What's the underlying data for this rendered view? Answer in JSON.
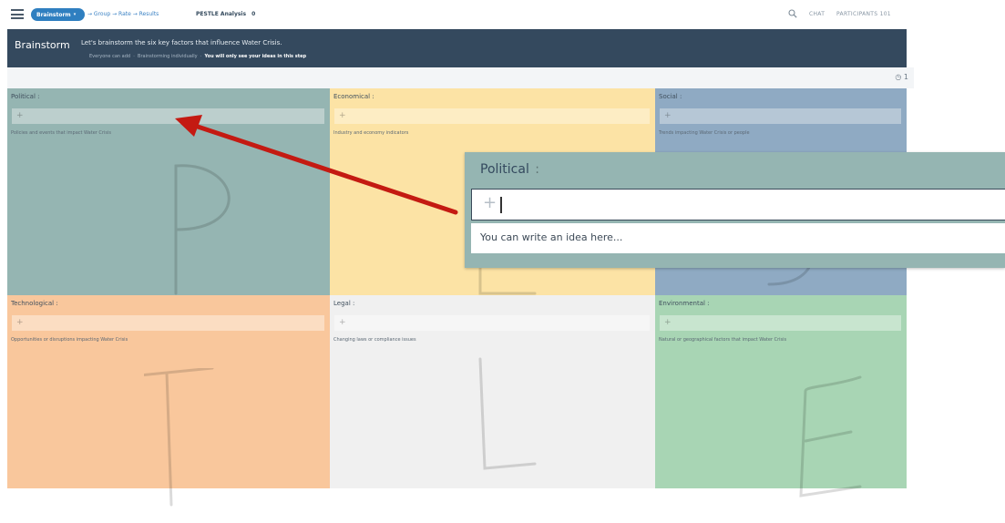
{
  "topbar": {
    "current_step": "Brainstorm",
    "steps_trail": "→ Group → Rate → Results",
    "board_title": "PESTLE Analysis",
    "board_count": "0",
    "chat_label": "CHAT",
    "participants_label": "PARTICIPANTS 101"
  },
  "banner": {
    "title": "Brainstorm",
    "instruction": "Let's brainstorm the six key factors that influence Water Crisis.",
    "sub_everyone": "Everyone can add",
    "sub_individual": "Brainstorming individually",
    "sub_visibility": "You will only see your ideas in this step"
  },
  "timer": "1",
  "quadrants": [
    {
      "title": "Political :",
      "hint": "Policies and events that impact Water Crisis",
      "letter": "P",
      "bg": "#95b5b2",
      "addbg": "#bccfcd"
    },
    {
      "title": "Economical :",
      "hint": "Industry and economy indicators",
      "letter": "E",
      "bg": "#fce3a5",
      "addbg": "#fdedc4"
    },
    {
      "title": "Social :",
      "hint": "Trends impacting Water Crisis or people",
      "letter": "S",
      "bg": "#8faac3",
      "addbg": "#b6c7d6"
    },
    {
      "title": "Technological :",
      "hint": "Opportunities or disruptions impacting Water Crisis",
      "letter": "T",
      "bg": "#f9c79c",
      "addbg": "#fbddc2"
    },
    {
      "title": "Legal :",
      "hint": "Changing laws or compliance issues",
      "letter": "L",
      "bg": "#f0f0f0",
      "addbg": "#f6f6f6"
    },
    {
      "title": "Environmental :",
      "hint": "Natural or geographical factors that impact Water Crisis",
      "letter": "E",
      "bg": "#a8d5b4",
      "addbg": "#c8e5cf"
    }
  ],
  "add_symbol": "+",
  "zoom": {
    "title": "Political",
    "title_suffix": ":",
    "placeholder": "You can write an idea here..."
  },
  "colors": {
    "accent": "#2f7fc0",
    "banner": "#34495e",
    "arrow": "#c41a12"
  }
}
